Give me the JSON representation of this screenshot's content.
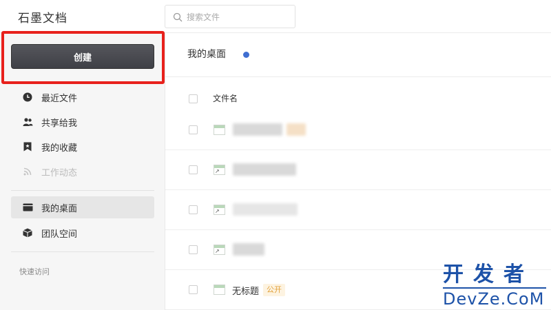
{
  "header": {
    "logo": "石墨文档",
    "search_placeholder": "搜索文件"
  },
  "sidebar": {
    "create_label": "创建",
    "items": [
      {
        "label": "最近文件",
        "icon": "clock-icon"
      },
      {
        "label": "共享给我",
        "icon": "people-icon"
      },
      {
        "label": "我的收藏",
        "icon": "bookmark-icon"
      },
      {
        "label": "工作动态",
        "icon": "rss-icon",
        "disabled": true
      },
      {
        "label": "我的桌面",
        "icon": "desktop-icon",
        "active": true
      },
      {
        "label": "团队空间",
        "icon": "cube-icon"
      }
    ],
    "quick_access": "快速访问"
  },
  "main": {
    "title": "我的桌面",
    "column_name": "文件名",
    "files": [
      {
        "name": "",
        "blurred": true
      },
      {
        "name": "",
        "blurred": true
      },
      {
        "name": "",
        "blurred": true
      },
      {
        "name": "",
        "blurred": true
      },
      {
        "name": "无标题",
        "badge": "公开"
      }
    ]
  },
  "watermark": {
    "cn": "开发者",
    "en": "DevZe.CoM"
  },
  "colors": {
    "highlight": "#e8211c",
    "create_button": "#46474d",
    "status_dot": "#3f6ed1",
    "badge_text": "#e2a23b",
    "watermark": "#1d52a8"
  }
}
